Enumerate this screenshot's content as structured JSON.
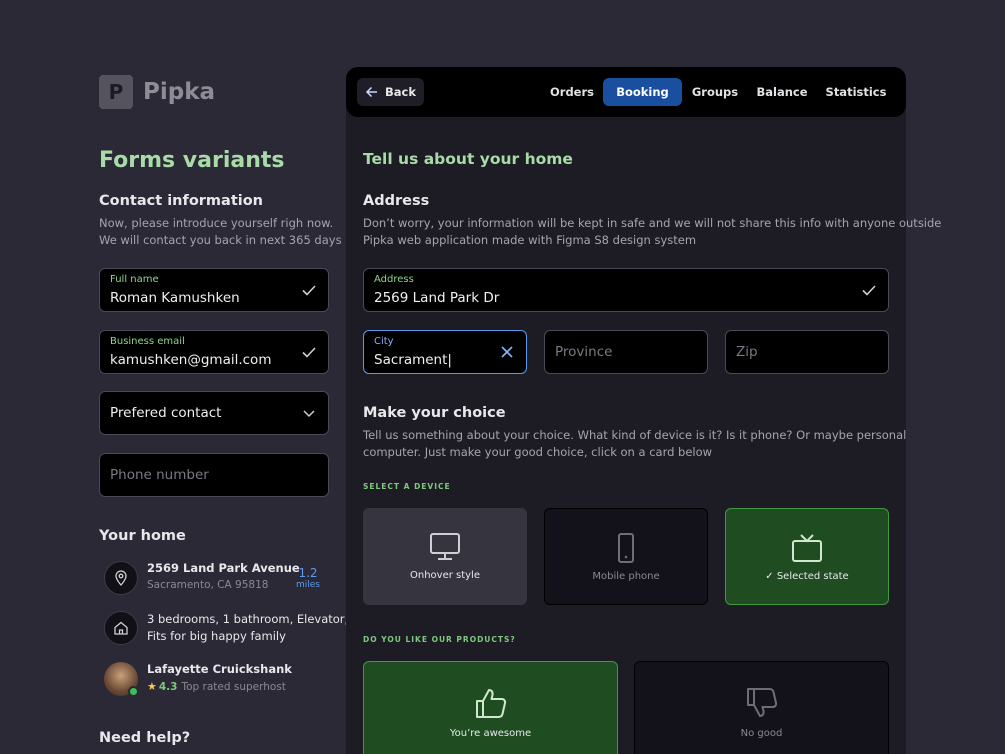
{
  "brand": {
    "logo_letter": "P",
    "name": "Pipka"
  },
  "page_title": "Forms variants",
  "contact": {
    "title": "Contact information",
    "desc_1": "Now, please introduce yourself righ now.",
    "desc_2": "We will contact you back in next 365 days",
    "full_name_label": "Full name",
    "full_name_value": "Roman Kamushken",
    "email_label": "Business email",
    "email_value": "kamushken@gmail.com",
    "preferred_contact": "Prefered contact",
    "phone_placeholder": "Phone number"
  },
  "home": {
    "title": "Your home",
    "address_main": "2569 Land Park Avenue",
    "address_sub": "Sacramento, CA 95818",
    "distance_value": "1.2",
    "distance_unit": "miles",
    "details_1": "3 bedrooms, 1 bathroom, Elevator,",
    "details_2": "Fits for big happy family",
    "host_name": "Lafayette Cruickshank",
    "host_rating": "4.3",
    "host_badge": "Top rated superhost"
  },
  "help_title": "Need help?",
  "nav": {
    "back": "Back",
    "tabs": [
      {
        "label": "Orders"
      },
      {
        "label": "Booking"
      },
      {
        "label": "Groups"
      },
      {
        "label": "Balance"
      },
      {
        "label": "Statistics"
      }
    ],
    "active_tab": "Booking"
  },
  "form": {
    "title": "Tell us about your home",
    "address_section": "Address",
    "address_desc_1": "Don’t worry, your information will be kept in safe and we will not share this info with anyone outside",
    "address_desc_2": "Pipka web application made with Figma S8 design system",
    "address_label": "Address",
    "address_value": "2569 Land Park Dr",
    "city_label": "City",
    "city_value": "Sacrament|",
    "province_placeholder": "Province",
    "zip_placeholder": "Zip"
  },
  "choice": {
    "title": "Make your choice",
    "desc_1": "Tell us something about your choice. What kind of device is it? Is it phone? Or maybe personal",
    "desc_2": "computer. Just make your good choice, click on a card below",
    "device_label": "SELECT A DEVICE",
    "devices": [
      {
        "label": "Onhover style",
        "icon": "monitor-icon",
        "state": "hover"
      },
      {
        "label": "Mobile phone",
        "icon": "phone-icon",
        "state": "default"
      },
      {
        "label": "✓ Selected state",
        "icon": "tv-icon",
        "state": "selected"
      }
    ],
    "products_label": "DO YOU LIKE OUR PRODUCTS?",
    "products": [
      {
        "label": "You’re awesome",
        "icon": "thumbs-up-icon",
        "state": "selected"
      },
      {
        "label": "No good",
        "icon": "thumbs-down-icon",
        "state": "default"
      }
    ]
  },
  "colors": {
    "background": "#2a2935",
    "accent_green": "#a8dba8",
    "accent_blue": "#1a4fa0",
    "selected_card": "#1f4d21",
    "focus_border": "#5b9bef"
  }
}
